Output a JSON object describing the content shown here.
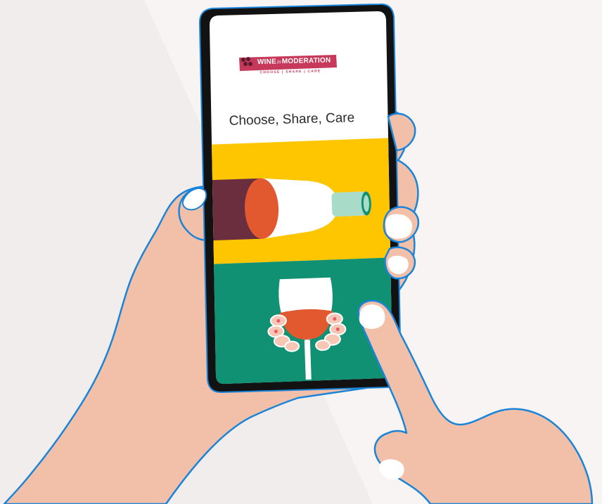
{
  "logo": {
    "word_wine": "WINE",
    "word_in": "in",
    "word_moderation": "MODERATION",
    "tagline": "CHOOSE | SHARE | CARE"
  },
  "screen": {
    "headline": "Choose, Share, Care"
  },
  "colors": {
    "background": "#f2eeee",
    "skin": "#f2bfa8",
    "hand_outline": "#1a84d8",
    "phone_frame": "#121212",
    "brand": "#c7395a",
    "yellow_panel": "#fdc600",
    "green_panel": "#119174",
    "bottle_top": "#6a2e3e",
    "bottle_neck": "#a8dcc8",
    "wine_rose": "#e2582f"
  }
}
